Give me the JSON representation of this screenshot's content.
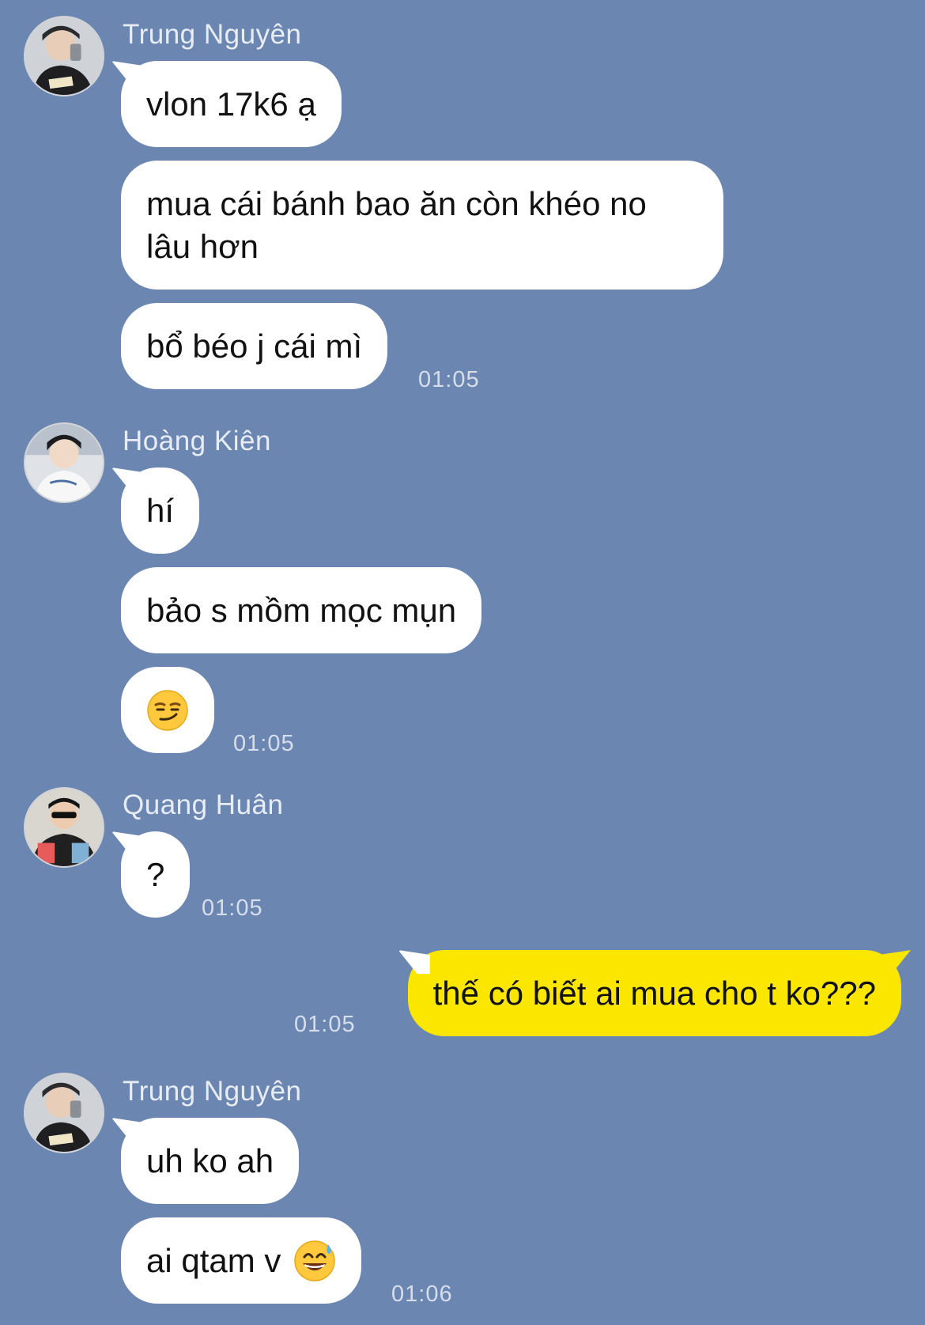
{
  "colors": {
    "background": "#6b86b0",
    "incoming_bubble": "#ffffff",
    "outgoing_bubble": "#fbe600",
    "text": "#111111",
    "meta_text": "#d6deeb"
  },
  "messages": [
    {
      "sender": "Trung Nguyên",
      "avatar": "trung-nguyen-avatar",
      "texts": [
        "vlon 17k6 ạ",
        "mua cái bánh bao ăn còn khéo no lâu hơn",
        "bổ béo j cái mì"
      ],
      "time": "01:05"
    },
    {
      "sender": "Hoàng Kiên",
      "avatar": "hoang-kien-avatar",
      "texts": [
        "hí",
        "bảo s mồm mọc mụn"
      ],
      "emoji": "smirking-face-emoji",
      "time": "01:05"
    },
    {
      "sender": "Quang Huân",
      "avatar": "quang-huan-avatar",
      "texts": [
        "?"
      ],
      "time": "01:05"
    },
    {
      "sender": "me",
      "texts": [
        "thế có biết ai mua cho t ko???"
      ],
      "time": "01:05"
    },
    {
      "sender": "Trung Nguyên",
      "avatar": "trung-nguyen-avatar",
      "texts": [
        "uh ko ah",
        "ai qtam v"
      ],
      "emoji": "grinning-sweat-emoji",
      "time": "01:06"
    }
  ]
}
